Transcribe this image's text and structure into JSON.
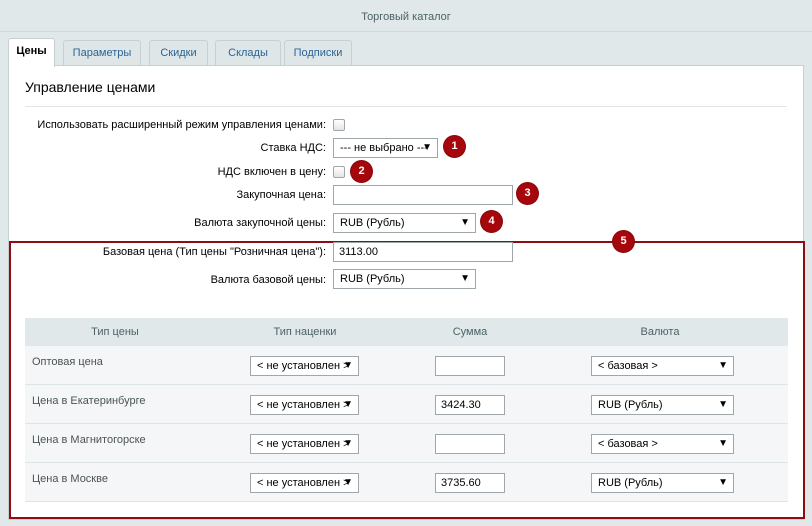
{
  "window": {
    "title": "Торговый каталог"
  },
  "tabs": [
    {
      "label": "Цены",
      "active": true
    },
    {
      "label": "Параметры",
      "active": false
    },
    {
      "label": "Скидки",
      "active": false
    },
    {
      "label": "Склады",
      "active": false
    },
    {
      "label": "Подписки",
      "active": false
    }
  ],
  "section": {
    "title": "Управление ценами"
  },
  "form": {
    "extended_mode_label": "Использовать расширенный режим управления ценами:",
    "vat_rate_label": "Ставка НДС:",
    "vat_rate_value": "--- не выбрано ---",
    "vat_included_label": "НДС включен в цену:",
    "purchase_price_label": "Закупочная цена:",
    "purchase_price_value": "",
    "purchase_currency_label": "Валюта закупочной цены:",
    "purchase_currency_value": "RUB (Рубль)",
    "base_price_label": "Базовая цена (Тип цены \"Розничная цена\"):",
    "base_price_value": "3113.00",
    "base_currency_label": "Валюта базовой цены:",
    "base_currency_value": "RUB (Рубль)"
  },
  "badges": [
    "1",
    "2",
    "3",
    "4",
    "5"
  ],
  "price_table": {
    "headers": [
      "Тип цены",
      "Тип наценки",
      "Сумма",
      "Валюта"
    ],
    "rows": [
      {
        "name": "Оптовая цена",
        "markup": "< не установлен >",
        "sum": "",
        "currency": "< базовая >"
      },
      {
        "name": "Цена в Екатеринбурге",
        "markup": "< не установлен >",
        "sum": "3424.30",
        "currency": "RUB (Рубль)"
      },
      {
        "name": "Цена в Магнитогорске",
        "markup": "< не установлен >",
        "sum": "",
        "currency": "< базовая >"
      },
      {
        "name": "Цена в Москве",
        "markup": "< не установлен >",
        "sum": "3735.60",
        "currency": "RUB (Рубль)"
      }
    ]
  },
  "icons": {
    "dropdown": "triangle-down-icon"
  },
  "colors": {
    "badge": "#a6070c",
    "highlight": "#8e0d12",
    "link": "#2a6496"
  }
}
